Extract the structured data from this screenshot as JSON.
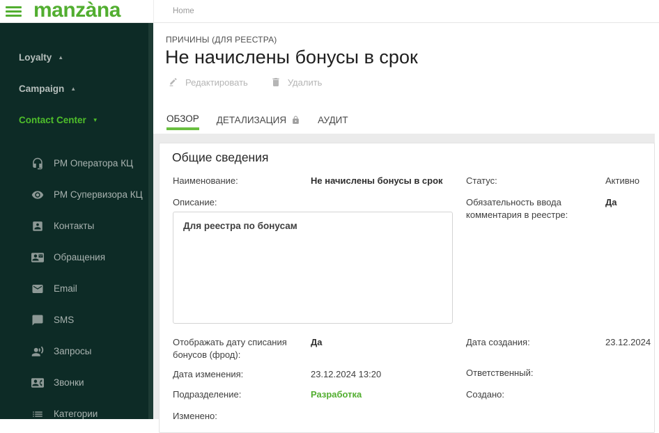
{
  "brand": {
    "logo": "manzàna"
  },
  "breadcrumb": {
    "home": "Home"
  },
  "colors": {
    "accent_green": "#52ae30",
    "tab_underline_green": "#6abf40",
    "sidebar_bg": "#0d2b26",
    "link_green": "#52ae30"
  },
  "sidebar": {
    "sections": [
      {
        "label": "Loyalty",
        "state": "collapsed-up",
        "icon": "chevron-up-icon"
      },
      {
        "label": "Campaign",
        "state": "collapsed-up",
        "icon": "chevron-up-icon"
      },
      {
        "label": "Contact Center",
        "state": "expanded",
        "icon": "chevron-down-icon",
        "active": true
      }
    ],
    "items": [
      {
        "label": "РМ Оператора КЦ",
        "icon": "headset-icon"
      },
      {
        "label": "РМ Супервизора КЦ",
        "icon": "eye-icon"
      },
      {
        "label": "Контакты",
        "icon": "contact-card-icon"
      },
      {
        "label": "Обращения",
        "icon": "contact-mail-icon"
      },
      {
        "label": "Email",
        "icon": "email-icon"
      },
      {
        "label": "SMS",
        "icon": "chat-icon"
      },
      {
        "label": "Запросы",
        "icon": "voice-request-icon"
      },
      {
        "label": "Звонки",
        "icon": "contact-phone-icon"
      },
      {
        "label": "Категории",
        "icon": "list-icon"
      }
    ]
  },
  "page": {
    "eyebrow": "ПРИЧИНЫ (ДЛЯ РЕЕСТРА)",
    "title": "Не начислены бонусы в срок",
    "toolbar": {
      "edit_label": "Редактировать",
      "delete_label": "Удалить"
    },
    "tabs": [
      {
        "label": "ОБЗОР",
        "active": true
      },
      {
        "label": "ДЕТАЛИЗАЦИЯ",
        "locked": true
      },
      {
        "label": "АУДИТ"
      }
    ]
  },
  "card": {
    "heading": "Общие сведения",
    "description_value": "Для реестра по бонусам",
    "left": [
      {
        "label": "Наименование:",
        "value": "Не начислены бонусы в срок"
      },
      {
        "label": "Описание:"
      },
      {
        "label": "Отображать дату списания бонусов (фрод):",
        "value": "Да"
      },
      {
        "label": "Дата изменения:",
        "value": "23.12.2024 13:20"
      },
      {
        "label": "Подразделение:",
        "value": "Разработка"
      },
      {
        "label": "Изменено:",
        "value": ""
      }
    ],
    "right": [
      {
        "label": "Статус:",
        "value": "Активно"
      },
      {
        "label": "Обязательность ввода комментария в реестре:",
        "value": "Да"
      },
      {
        "label": "Дата создания:",
        "value": "23.12.2024"
      },
      {
        "label": "Ответственный:",
        "value": ""
      },
      {
        "label": "Создано:",
        "value": ""
      }
    ]
  }
}
